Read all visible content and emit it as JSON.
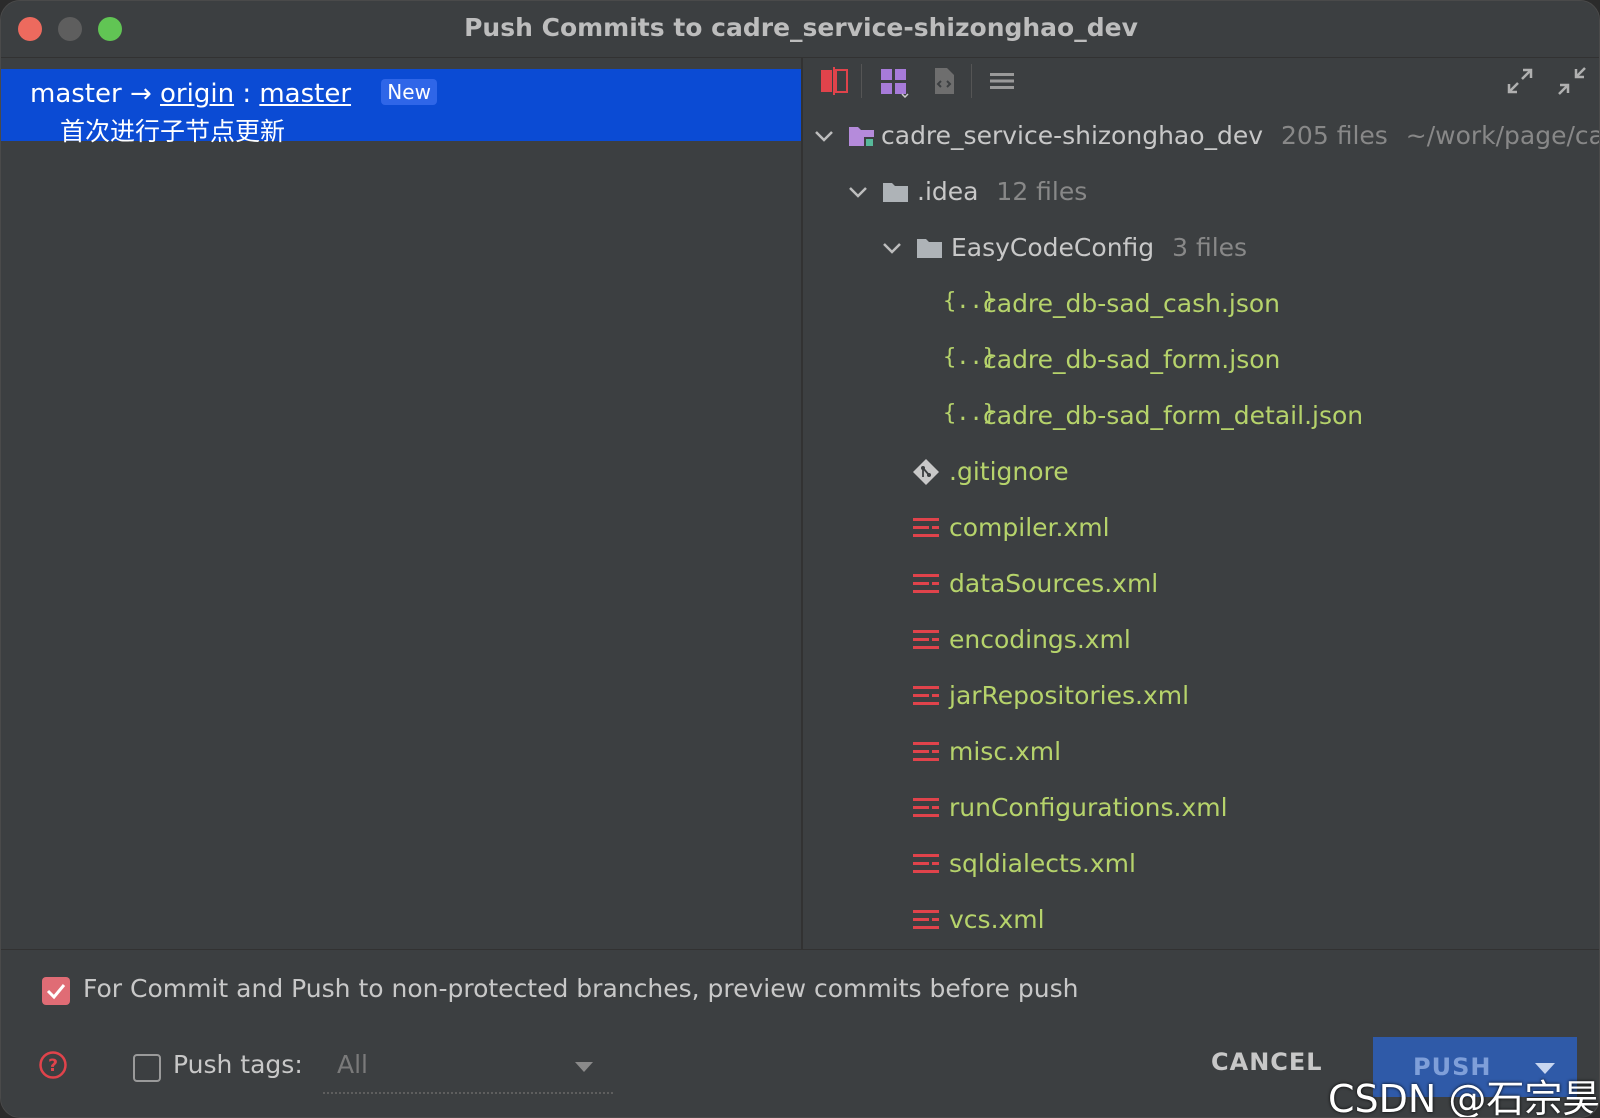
{
  "window": {
    "title": "Push Commits to cadre_service-shizonghao_dev"
  },
  "commit": {
    "local_branch": "master",
    "arrow": "→",
    "remote": "origin",
    "separator": ":",
    "remote_branch": "master",
    "badge": "New",
    "message": "首次进行子节点更新"
  },
  "tree": {
    "root": {
      "name": "cadre_service-shizonghao_dev",
      "count": "205 files",
      "path": "~/work/page/cad"
    },
    "idea": {
      "name": ".idea",
      "count": "12 files"
    },
    "easycode": {
      "name": "EasyCodeConfig",
      "count": "3 files"
    },
    "json_files": [
      "cadre_db-sad_cash.json",
      "cadre_db-sad_form.json",
      "cadre_db-sad_form_detail.json"
    ],
    "gitignore": ".gitignore",
    "xml_files": [
      "compiler.xml",
      "dataSources.xml",
      "encodings.xml",
      "jarRepositories.xml",
      "misc.xml",
      "runConfigurations.xml",
      "sqldialects.xml",
      "vcs.xml"
    ]
  },
  "footer": {
    "preview_label": "For Commit and Push to non-protected branches, preview commits before push",
    "push_tags_label": "Push tags:",
    "push_tags_value": "All",
    "cancel_label": "CANCEL",
    "push_label": "PUSH"
  },
  "watermark": "CSDN @石宗昊",
  "colors": {
    "selection": "#0b4bd4",
    "file_green": "#b6d36b",
    "xml_red": "#e0434b",
    "checkbox": "#e06c75"
  }
}
